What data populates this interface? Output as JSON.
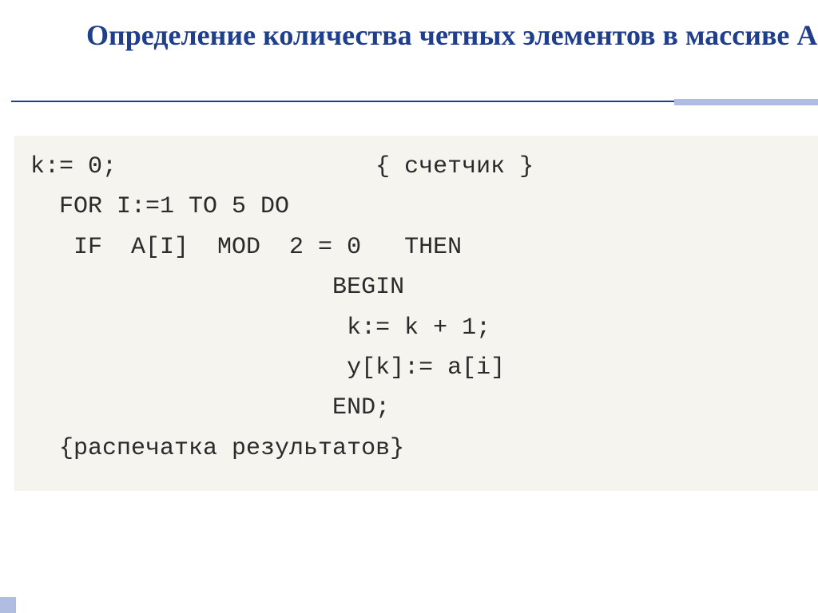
{
  "title": "Определение количества четных элементов в массиве А",
  "code": {
    "line1": "k:= 0;                  { счетчик }",
    "line2": "  FOR I:=1 TO 5 DO",
    "line3": "   IF  A[I]  MOD  2 = 0   THEN",
    "line4": "                     BEGIN",
    "line5": "                      k:= k + 1;",
    "line6": "                      y[k]:= a[i]",
    "line7": "                     END;",
    "line8": "",
    "line9": "  {распечатка результатов}"
  }
}
